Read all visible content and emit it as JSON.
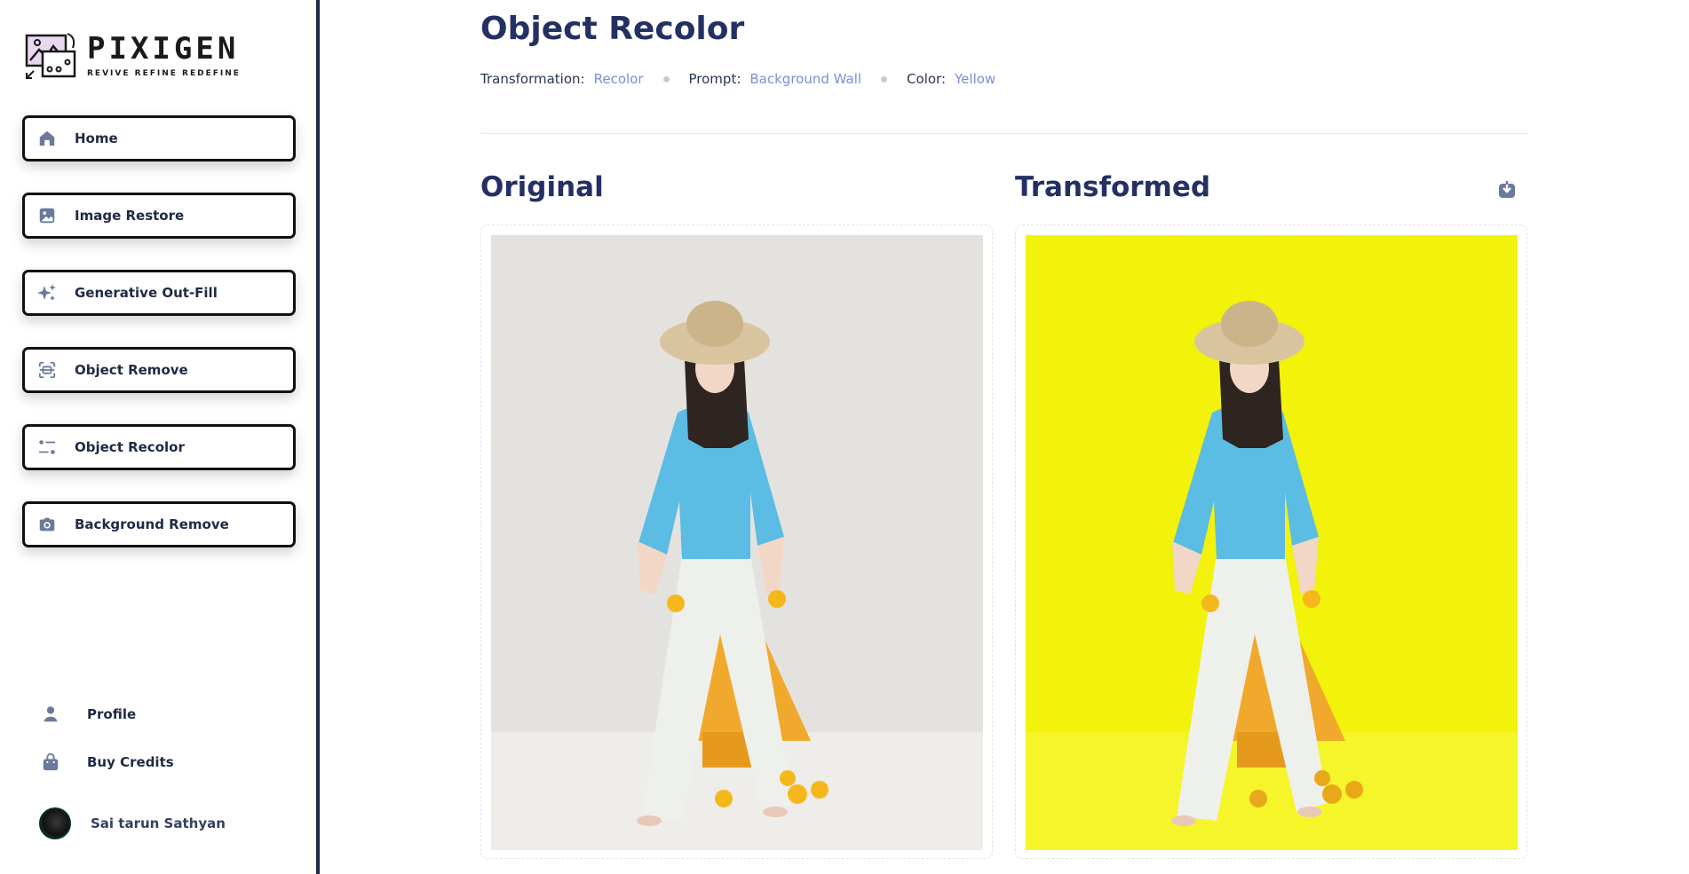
{
  "brand": {
    "name": "PIXIGEN",
    "tagline": "REVIVE REFINE REDEFINE"
  },
  "sidebar": {
    "items": [
      {
        "label": "Home",
        "icon": "home-icon"
      },
      {
        "label": "Image Restore",
        "icon": "image-icon"
      },
      {
        "label": "Generative Out-Fill",
        "icon": "sparkles-icon"
      },
      {
        "label": "Object Remove",
        "icon": "scan-icon"
      },
      {
        "label": "Object Recolor",
        "icon": "filter-icon"
      },
      {
        "label": "Background Remove",
        "icon": "camera-icon"
      }
    ],
    "bottom": [
      {
        "label": "Profile",
        "icon": "user-icon"
      },
      {
        "label": "Buy Credits",
        "icon": "bag-icon"
      }
    ],
    "user": {
      "name": "Sai tarun Sathyan"
    }
  },
  "page": {
    "title": "Object Recolor",
    "meta": {
      "transformation_label": "Transformation:",
      "transformation_value": "Recolor",
      "prompt_label": "Prompt:",
      "prompt_value": "Background Wall",
      "color_label": "Color:",
      "color_value": "Yellow"
    },
    "original_title": "Original",
    "transformed_title": "Transformed"
  },
  "colors": {
    "accent": "#243064",
    "link": "#7d8ed6",
    "original_bg": "#e4e2de",
    "transformed_bg": "#f2f20a"
  }
}
